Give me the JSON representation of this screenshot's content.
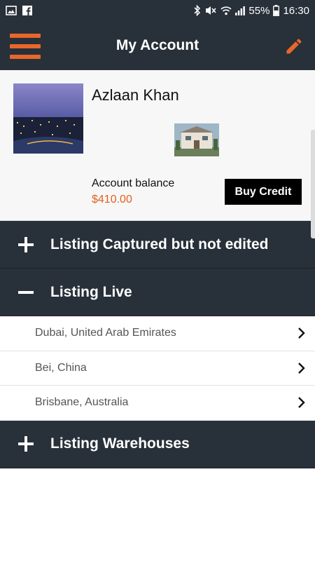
{
  "status_bar": {
    "battery": "55%",
    "time": "16:30"
  },
  "app_bar": {
    "title": "My Account"
  },
  "profile": {
    "name": "Azlaan Khan",
    "balance_label": "Account balance",
    "balance_value": "$410.00",
    "buy_credit_label": "Buy Credit"
  },
  "sections": [
    {
      "title": "Listing Captured but not edited",
      "expanded": false
    },
    {
      "title": "Listing Live",
      "expanded": true,
      "items": [
        {
          "label": "Dubai, United Arab Emirates"
        },
        {
          "label": "Bei, China"
        },
        {
          "label": "Brisbane, Australia"
        }
      ]
    },
    {
      "title": "Listing Warehouses",
      "expanded": false
    }
  ],
  "colors": {
    "bar": "#283039",
    "accent": "#e8672a",
    "balance": "#e0611f"
  }
}
